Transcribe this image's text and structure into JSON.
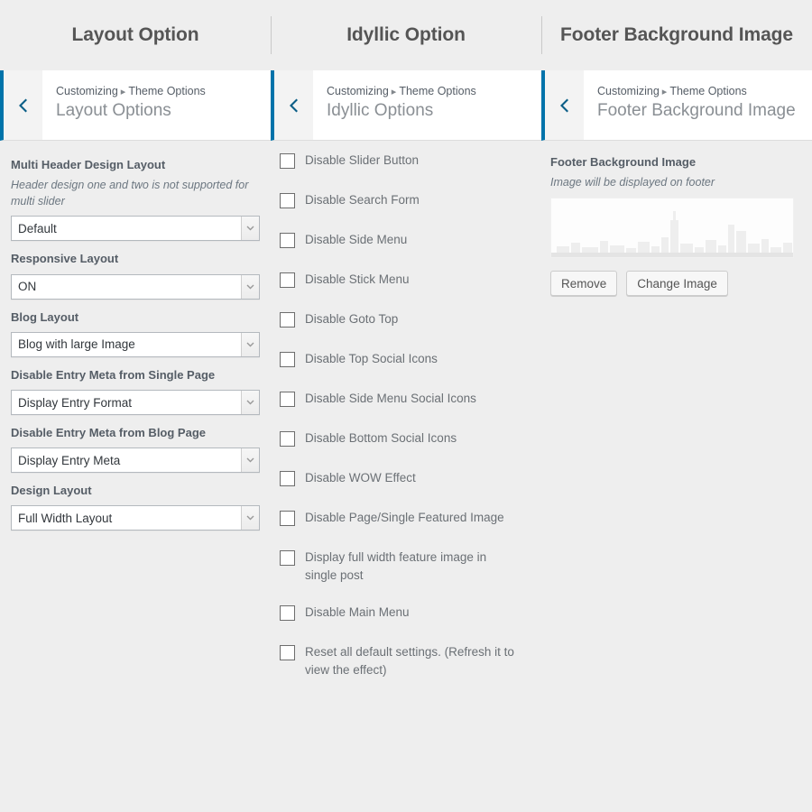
{
  "columns": [
    {
      "header": "Layout Option"
    },
    {
      "header": "Idyllic Option"
    },
    {
      "header": "Footer Background Image"
    }
  ],
  "panels": [
    {
      "back_icon": "chevron-left-icon",
      "breadcrumb_root": "Customizing",
      "breadcrumb_separator": "▸",
      "breadcrumb_parent": "Theme Options",
      "title": "Layout Options"
    },
    {
      "back_icon": "chevron-left-icon",
      "breadcrumb_root": "Customizing",
      "breadcrumb_separator": "▸",
      "breadcrumb_parent": "Theme Options",
      "title": "Idyllic Options"
    },
    {
      "back_icon": "chevron-left-icon",
      "breadcrumb_root": "Customizing",
      "breadcrumb_separator": "▸",
      "breadcrumb_parent": "Theme Options",
      "title": "Footer Background Image"
    }
  ],
  "layout_options": {
    "fields": [
      {
        "label": "Multi Header Design Layout",
        "description": "Header design one and two is not supported for multi slider",
        "value": "Default"
      },
      {
        "label": "Responsive Layout",
        "description": "",
        "value": "ON"
      },
      {
        "label": "Blog Layout",
        "description": "",
        "value": "Blog with large Image"
      },
      {
        "label": "Disable Entry Meta from Single Page",
        "description": "",
        "value": "Display Entry Format"
      },
      {
        "label": "Disable Entry Meta from Blog Page",
        "description": "",
        "value": "Display Entry Meta"
      },
      {
        "label": "Design Layout",
        "description": "",
        "value": "Full Width Layout"
      }
    ]
  },
  "idyllic_options": {
    "checkboxes": [
      {
        "label": "Disable Slider Button",
        "checked": false
      },
      {
        "label": "Disable Search Form",
        "checked": false
      },
      {
        "label": "Disable Side Menu",
        "checked": false
      },
      {
        "label": "Disable Stick Menu",
        "checked": false
      },
      {
        "label": "Disable Goto Top",
        "checked": false
      },
      {
        "label": "Disable Top Social Icons",
        "checked": false
      },
      {
        "label": "Disable Side Menu Social Icons",
        "checked": false
      },
      {
        "label": "Disable Bottom Social Icons",
        "checked": false
      },
      {
        "label": "Disable WOW Effect",
        "checked": false
      },
      {
        "label": "Disable Page/Single Featured Image",
        "checked": false
      },
      {
        "label": "Display full width feature image in single post",
        "checked": false
      },
      {
        "label": "Disable Main Menu",
        "checked": false
      },
      {
        "label": "Reset all default settings. (Refresh it to view the effect)",
        "checked": false
      }
    ]
  },
  "footer_background_image": {
    "label": "Footer Background Image",
    "description": "Image will be displayed on footer",
    "thumbnail_alt": "city-skyline-thumbnail",
    "remove_label": "Remove",
    "change_label": "Change Image"
  },
  "colors": {
    "accent_blue": "#0073aa",
    "page_background": "#eeeeee",
    "panel_background": "#ffffff",
    "label_text": "#555d66",
    "muted_text": "#8a8f94"
  }
}
